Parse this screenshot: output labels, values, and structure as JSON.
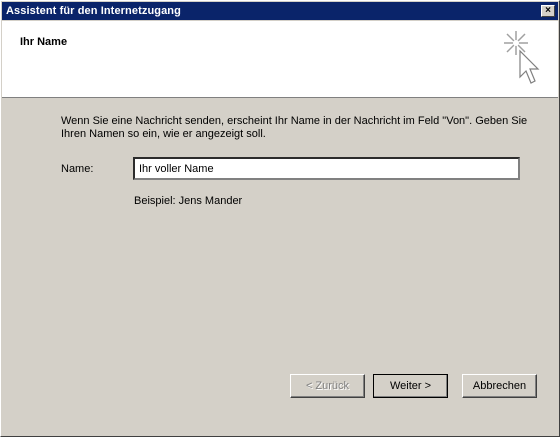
{
  "window": {
    "title": "Assistent für den Internetzugang",
    "close_glyph": "×"
  },
  "header": {
    "title": "Ihr Name",
    "icon": "wizard-sparkle-cursor-icon"
  },
  "content": {
    "intro": "Wenn Sie eine Nachricht senden, erscheint Ihr Name in der Nachricht im Feld \"Von\". Geben Sie Ihren Namen so ein, wie er angezeigt soll.",
    "name_label": "Name:",
    "name_value": "Ihr voller Name",
    "example": "Beispiel: Jens Mander"
  },
  "buttons": {
    "back": "< Zurück",
    "next": "Weiter >",
    "cancel": "Abbrechen"
  },
  "colors": {
    "titlebar": "#0a246a",
    "face": "#d4d0c8",
    "header_bg": "#ffffff"
  }
}
